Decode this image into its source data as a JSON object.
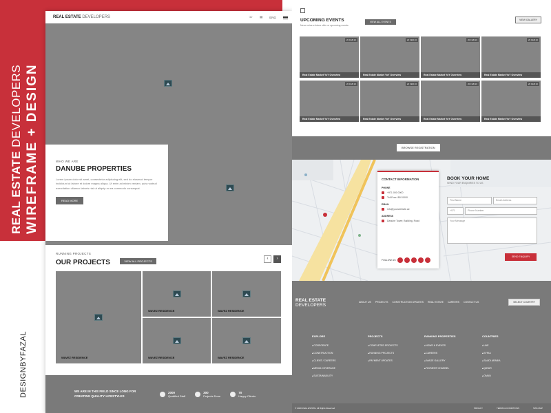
{
  "cover": {
    "title_bold": "REAL ESTATE",
    "title_light": "DEVELOPERS",
    "subtitle": "WIREFRAME + DESIGN",
    "credit": "DESIGNBYFAZAL",
    "accent": "#c8303a"
  },
  "left_page": {
    "nav": {
      "logo_bold": "REAL ESTATE",
      "logo_light": "DEVELOPERS",
      "lang": "ENG"
    },
    "about": {
      "eyebrow": "WHO WE ARE",
      "title": "DANUBE PROPERTIES",
      "body": "Lorem ipsum dolor sit amet, consectetur adipiscing elit, sed do eiusmod tempor incididunt ut labore et dolore magna aliqua. Ut enim ad minim veniam, quis nostrud exercitation ullamco laboris nisi ut aliquip ex ea commodo consequat.",
      "button": "READ MORE"
    },
    "projects": {
      "eyebrow": "RUNNING PROJECTS",
      "title": "OUR PROJECTS",
      "filter": "VIEW ALL PROJECTS",
      "cards": [
        "WAVEZ RESIDENCE",
        "WAVEZ RESIDENCE",
        "WAVEZ RESIDENCE",
        "WAVEZ RESIDENCE",
        "WAVEZ RESIDENCE"
      ]
    },
    "stats": {
      "text": "WE ARE IN THIS FIELD SINCE LONG FOR CREATING QUALITY LIFESTYLES",
      "items": [
        {
          "value": "2000",
          "label": "Qualified Staff"
        },
        {
          "value": "300",
          "label": "Projects Done"
        },
        {
          "value": "70",
          "label": "Happy Clients"
        }
      ]
    }
  },
  "right_page": {
    "events": {
      "title": "UPCOMING EVENTS",
      "subtitle": "Never miss a future offer or upcoming events",
      "filter": "VIEW ALL EVENTS",
      "gallery": "VIEW GALLERY",
      "tag": "20 FEB 20",
      "card_caption": "Real Estate Market YoY Overview"
    },
    "band_button": "BROWSE REGISTRATION",
    "contact": {
      "title": "CONTACT INFORMATION",
      "phone_label": "PHONE",
      "phone1": "+971 000 0000",
      "phone2": "Toll Free: 800 0000",
      "email_label": "EMAIL",
      "email": "info@yourwebsite.ae",
      "address_label": "ADDRESS",
      "address": "Danube Tower, Building, Road",
      "follow": "FOLLOW US"
    },
    "book": {
      "title": "BOOK YOUR HOME",
      "subtitle": "SEND YOUR ENQUIRIES TO US",
      "first_name": "First Name",
      "email": "Email Address",
      "code": "+971",
      "phone": "Phone Number",
      "message": "Your Message",
      "send": "SEND ENQUIRY"
    },
    "footer": {
      "logo_bold": "REAL ESTATE",
      "logo_light": "DEVELOPERS",
      "nav": [
        "ABOUT US",
        "PROJECTS",
        "CONSTRUCTION UPDATES",
        "REAL ESTATE",
        "CAREERS",
        "CONTACT US"
      ],
      "select": "SELECT COUNTRY",
      "columns": [
        {
          "title": "EXPLORE",
          "items": [
            "CORPORATE",
            "CONSTRUCTION",
            "CLIENT / CAREERS",
            "MEDIA COVERAGE",
            "SUSTAINABILITY"
          ]
        },
        {
          "title": "PROJECTS",
          "items": [
            "COMPLETED PROJECTS",
            "RUNNING PROJECTS",
            "PAYMENT UPDATES"
          ]
        },
        {
          "title": "RANKING PROPERTIES",
          "items": [
            "NEWS & EVENTS",
            "CAREERS",
            "IMAGE GALLERY",
            "PAYMENT CHANNEL"
          ]
        },
        {
          "title": "COUNTRIES",
          "items": [
            "UAE",
            "SYRIA",
            "SAUDI ARABIA",
            "QATAR",
            "OMAN"
          ]
        }
      ],
      "copyright": "© 2020 REAL ESTATE. All Rights Reserved",
      "bottom_links": [
        "PRIVACY",
        "TERMS & CONDITIONS",
        "SITE MAP"
      ]
    }
  }
}
